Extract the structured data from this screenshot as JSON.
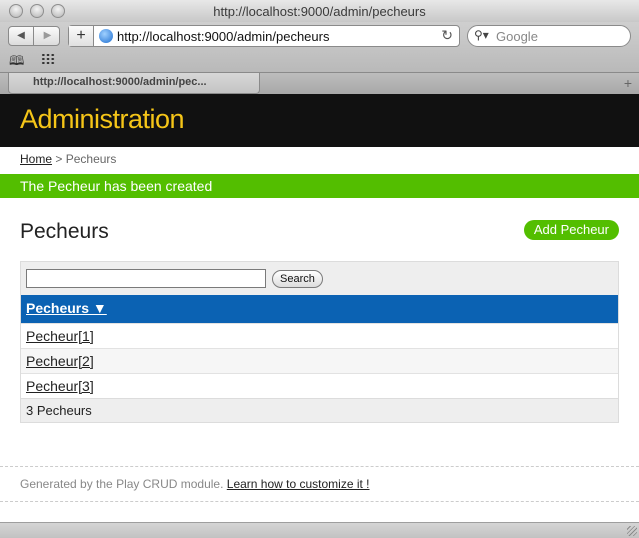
{
  "window": {
    "title": "http://localhost:9000/admin/pecheurs"
  },
  "toolbar": {
    "back_icon": "◀",
    "forward_icon": "▶",
    "plus_label": "+",
    "url": "http://localhost:9000/admin/pecheurs",
    "reload_icon": "↻",
    "search_icon": "⚲▾",
    "search_placeholder": "Google",
    "bookmarks_icon": "🕮"
  },
  "tabs": [
    {
      "label": "http://localhost:9000/admin/pec..."
    }
  ],
  "new_tab": "+",
  "header": {
    "title": "Administration"
  },
  "breadcrumb": {
    "home": "Home",
    "separator": ">",
    "current": "Pecheurs"
  },
  "flash": {
    "message": "The Pecheur has been created"
  },
  "main": {
    "title": "Pecheurs",
    "add_button": "Add Pecheur",
    "search": {
      "value": "",
      "button": "Search"
    },
    "column_header": "Pecheurs ▼",
    "rows": [
      "Pecheur[1]",
      "Pecheur[2]",
      "Pecheur[3]"
    ],
    "count": "3 Pecheurs"
  },
  "footer": {
    "generated_text": "Generated by the Play CRUD module.",
    "learn_link": "Learn how to customize it !"
  },
  "colors": {
    "header_bg": "#111111",
    "title": "#f5c518",
    "accent_green": "#53be00",
    "list_header_blue": "#0b62b3"
  }
}
